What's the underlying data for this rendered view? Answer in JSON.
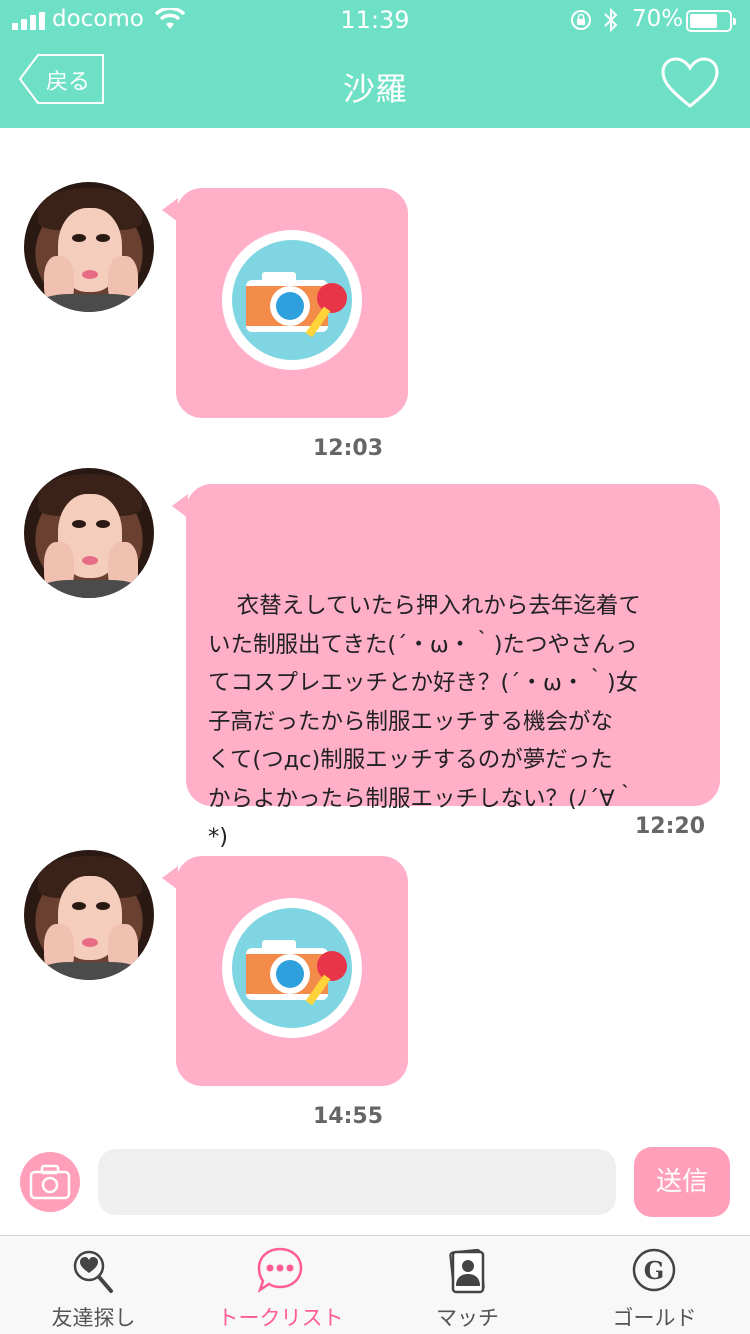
{
  "status_bar": {
    "carrier": "docomo",
    "time": "11:39",
    "battery": "70%",
    "battery_level": 0.7
  },
  "header": {
    "back_label": "戻る",
    "title": "沙羅"
  },
  "messages": [
    {
      "type": "locked-photo",
      "timestamp": "12:03"
    },
    {
      "type": "text",
      "text": "衣替えしていたら押入れから去年迄着て\nいた制服出てきた(´・ω・｀)たつやさんっ\nてコスプレエッチとか好き？(´・ω・｀)女\n子高だったから制服エッチする機会がな\nくて(つдc)制服エッチするのが夢だった\nからよかったら制服エッチしない？(ﾉ´∀｀\n*)",
      "timestamp": "12:20"
    },
    {
      "type": "locked-photo",
      "timestamp": "14:55"
    }
  ],
  "composer": {
    "input_value": "",
    "send_label": "送信"
  },
  "tabs": [
    {
      "label": "友達探し",
      "icon": "search-heart-icon"
    },
    {
      "label": "トークリスト",
      "icon": "chat-bubble-icon",
      "active": true
    },
    {
      "label": "マッチ",
      "icon": "profile-cards-icon"
    },
    {
      "label": "ゴールド",
      "icon": "gold-coin-icon"
    }
  ],
  "colors": {
    "header": "#6ee0c5",
    "bubble": "#ffafc7",
    "accent_pink": "#ff5c93",
    "button_pink": "#ff9fba"
  }
}
